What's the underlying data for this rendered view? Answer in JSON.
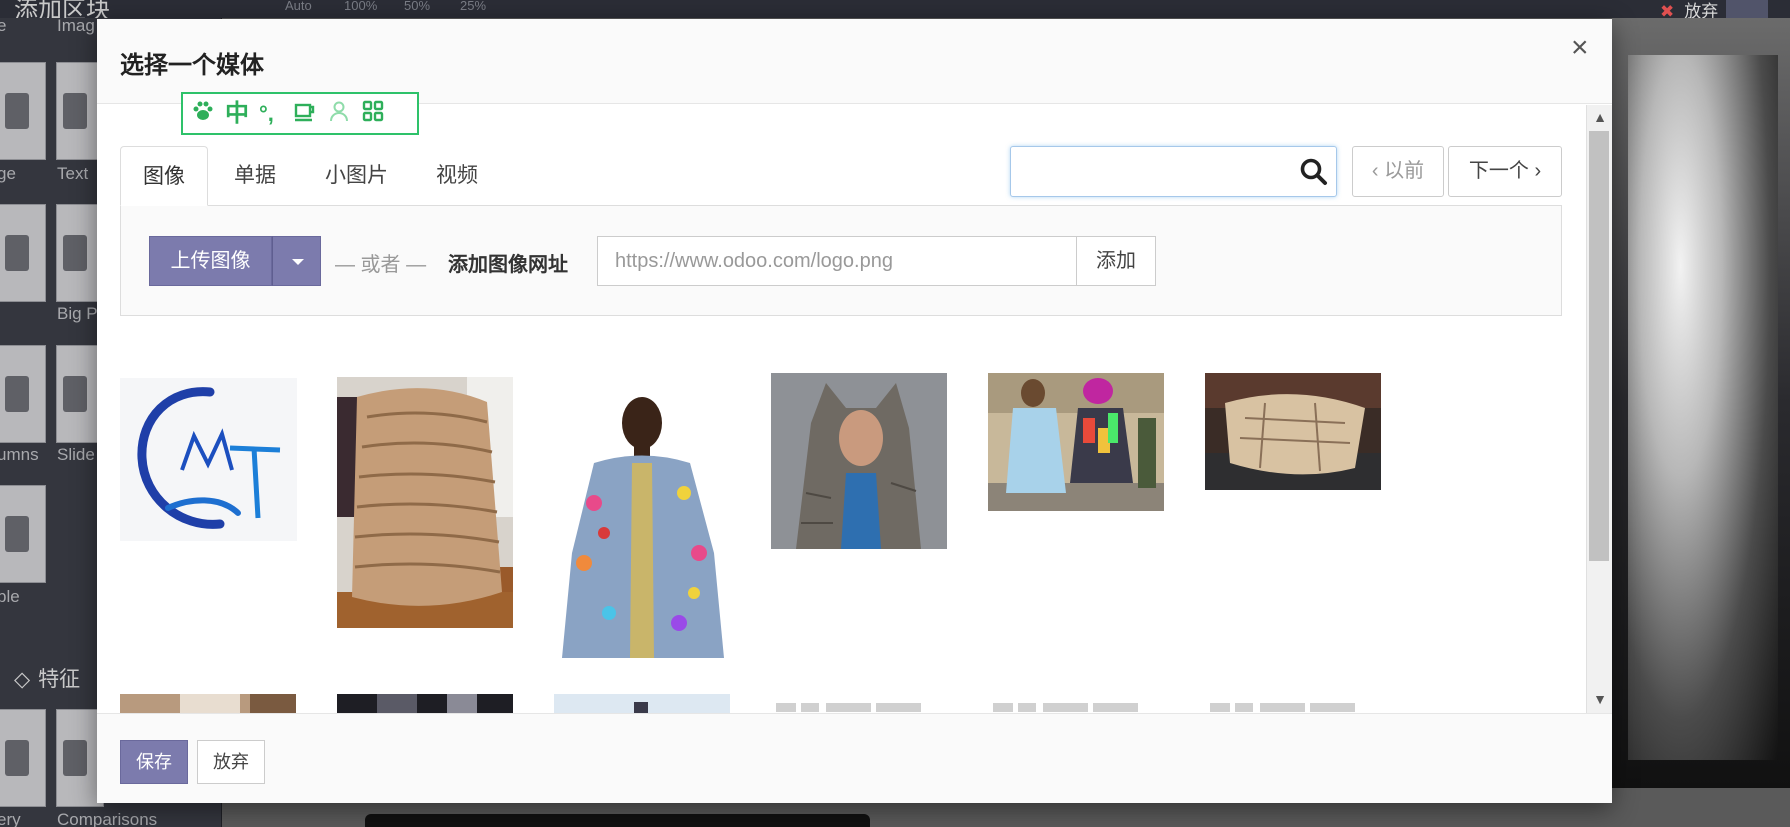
{
  "background": {
    "panel_title": "添加区块",
    "toolbar_items": [
      "Auto",
      "100%",
      "50%",
      "25%"
    ],
    "discard_label": "放弃",
    "sidebar_labels": [
      "e",
      "Imag",
      "ge",
      "Text",
      "Big P",
      "umns",
      "Slide",
      "ble",
      "ery",
      "Comparisons"
    ],
    "features_heading": "特征"
  },
  "ime_toolbar": {
    "items": [
      "paw-icon",
      "中",
      "°,",
      "cup-icon",
      "user-icon",
      "grid-icon"
    ],
    "color": "#2eaf5a"
  },
  "modal": {
    "title": "选择一个媒体",
    "close_label": "×",
    "tabs": [
      {
        "label": "图像",
        "active": true
      },
      {
        "label": "单据",
        "active": false
      },
      {
        "label": "小图片",
        "active": false
      },
      {
        "label": "视频",
        "active": false
      }
    ],
    "search": {
      "value": "",
      "placeholder": ""
    },
    "pager": {
      "prev_label": "‹ 以前",
      "next_label": "下一个 ›"
    },
    "upload": {
      "upload_label": "上传图像",
      "or_label": "— 或者 —",
      "add_url_label": "添加图像网址",
      "url_placeholder": "https://www.odoo.com/logo.png",
      "add_label": "添加"
    },
    "images": [
      {
        "name": "cmt-logo-image"
      },
      {
        "name": "knit-fur-throw-image"
      },
      {
        "name": "feather-fur-coat-image"
      },
      {
        "name": "wolf-hood-coat-image"
      },
      {
        "name": "street-style-furs-image"
      },
      {
        "name": "fox-fur-blanket-image"
      },
      {
        "name": "fur-shop-image"
      },
      {
        "name": "runway-image"
      },
      {
        "name": "model-sky-image"
      },
      {
        "name": "text-thumb-1"
      },
      {
        "name": "text-thumb-2"
      },
      {
        "name": "text-thumb-3"
      }
    ],
    "footer": {
      "save_label": "保存",
      "discard_label": "放弃"
    },
    "accent_color": "#7c7bad"
  }
}
